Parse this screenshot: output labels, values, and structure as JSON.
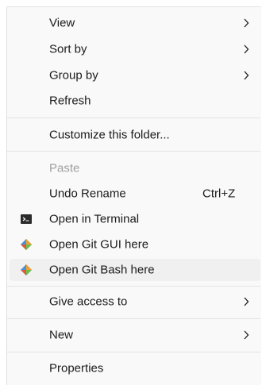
{
  "menu": {
    "items": {
      "view": {
        "label": "View"
      },
      "sort_by": {
        "label": "Sort by"
      },
      "group_by": {
        "label": "Group by"
      },
      "refresh": {
        "label": "Refresh"
      },
      "customize": {
        "label": "Customize this folder..."
      },
      "paste": {
        "label": "Paste"
      },
      "undo_rename": {
        "label": "Undo Rename",
        "shortcut": "Ctrl+Z"
      },
      "open_terminal": {
        "label": "Open in Terminal",
        "icon": "terminal-icon"
      },
      "open_git_gui": {
        "label": "Open Git GUI here",
        "icon": "git-icon"
      },
      "open_git_bash": {
        "label": "Open Git Bash here",
        "icon": "git-icon"
      },
      "give_access": {
        "label": "Give access to"
      },
      "new": {
        "label": "New"
      },
      "properties": {
        "label": "Properties"
      }
    },
    "colors": {
      "background": "#f9f9f9",
      "hover": "#f0f0f0",
      "text": "#1b1b1b",
      "disabled_text": "#a0a0a0",
      "git_blue": "#4a90d9",
      "git_orange": "#f0a030",
      "git_red": "#e05a3a",
      "git_green": "#6cc04a"
    }
  }
}
